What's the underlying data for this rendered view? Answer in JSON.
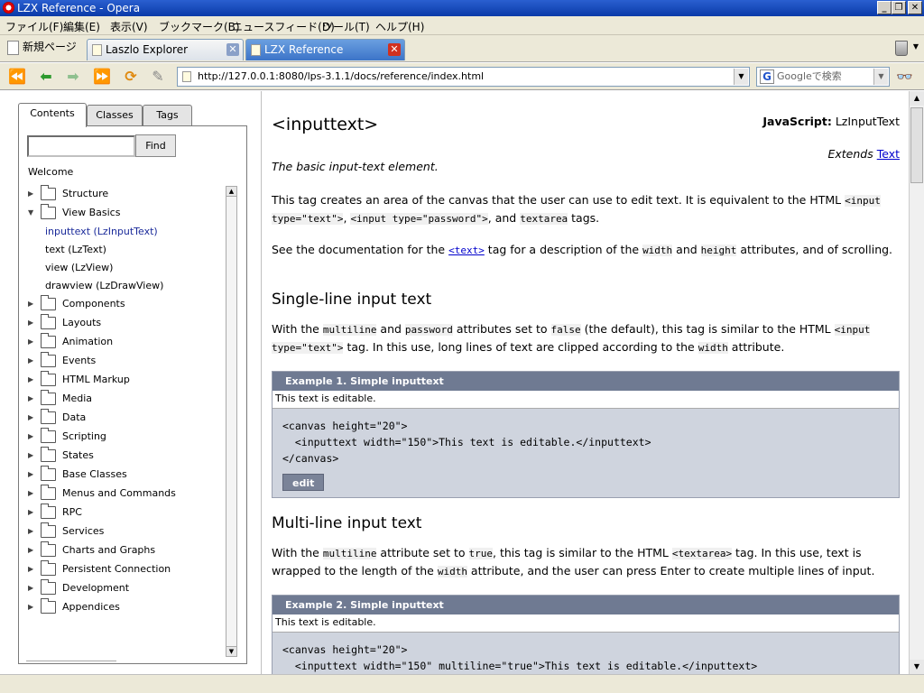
{
  "window": {
    "title": "LZX Reference - Opera"
  },
  "menubar": [
    "ファイル(F)",
    "編集(E)",
    "表示(V)",
    "ブックマーク(B)",
    "ニュースフィード(D)",
    "ツール(T)",
    "ヘルプ(H)"
  ],
  "tabs": {
    "new_page": "新規ページ",
    "items": [
      {
        "label": "Laszlo Explorer",
        "active": false
      },
      {
        "label": "LZX Reference",
        "active": true
      }
    ]
  },
  "navbar": {
    "url": "http://127.0.0.1:8080/lps-3.1.1/docs/reference/index.html",
    "search_placeholder": "Googleで検索"
  },
  "sidebar": {
    "tabs": [
      "Contents",
      "Classes",
      "Tags"
    ],
    "find_label": "Find",
    "find_value": "",
    "welcome": "Welcome",
    "tree": [
      {
        "label": "Structure",
        "type": "folder",
        "expanded": false
      },
      {
        "label": "View Basics",
        "type": "folder",
        "expanded": true
      },
      {
        "label": "inputtext (LzInputText)",
        "type": "child",
        "selected": true
      },
      {
        "label": "text (LzText)",
        "type": "child"
      },
      {
        "label": "view (LzView)",
        "type": "child"
      },
      {
        "label": "drawview (LzDrawView)",
        "type": "child"
      },
      {
        "label": "Components",
        "type": "folder"
      },
      {
        "label": "Layouts",
        "type": "folder"
      },
      {
        "label": "Animation",
        "type": "folder"
      },
      {
        "label": "Events",
        "type": "folder"
      },
      {
        "label": "HTML Markup",
        "type": "folder"
      },
      {
        "label": "Media",
        "type": "folder"
      },
      {
        "label": "Data",
        "type": "folder"
      },
      {
        "label": "Scripting",
        "type": "folder"
      },
      {
        "label": "States",
        "type": "folder"
      },
      {
        "label": "Base Classes",
        "type": "folder"
      },
      {
        "label": "Menus and Commands",
        "type": "folder"
      },
      {
        "label": "RPC",
        "type": "folder"
      },
      {
        "label": "Services",
        "type": "folder"
      },
      {
        "label": "Charts and Graphs",
        "type": "folder"
      },
      {
        "label": "Persistent Connection",
        "type": "folder"
      },
      {
        "label": "Development",
        "type": "folder"
      },
      {
        "label": "Appendices",
        "type": "folder"
      }
    ]
  },
  "doc": {
    "title": "<inputtext>",
    "js_label": "JavaScript:",
    "js_class": "LzInputText",
    "extends_label": "Extends",
    "extends_link": "Text",
    "summary": "The basic input-text element.",
    "p1": {
      "a": "This tag creates an area of the canvas that the user can use to edit text. It is equivalent to the HTML ",
      "c1": "<input type=\"text\">",
      "b": ", ",
      "c2": "<input type=\"password\">",
      "c": ", and ",
      "c3": "textarea",
      "d": " tags."
    },
    "p2": {
      "a": "See the documentation for the ",
      "link": "<text>",
      "b": " tag for a description of the ",
      "c1": "width",
      "c": " and ",
      "c2": "height",
      "d": " attributes, and of scrolling."
    },
    "h_single": "Single-line input text",
    "p3": {
      "a": "With the ",
      "c1": "multiline",
      "b": " and ",
      "c2": "password",
      "c": " attributes set to ",
      "c3": "false",
      "d": " (the default), this tag is similar to the HTML ",
      "c4": "<input type=\"text\">",
      "e": " tag. In this use, long lines of text are clipped according to the ",
      "c5": "width",
      "f": " attribute."
    },
    "example1": {
      "header": "Example 1. Simple inputtext",
      "live_text": "This text is editable.",
      "code": "<canvas height=\"20\">\n  <inputtext width=\"150\">This text is editable.</inputtext>\n</canvas>",
      "edit": "edit"
    },
    "h_multi": "Multi-line input text",
    "p4": {
      "a": "With the ",
      "c1": "multiline",
      "b": " attribute set to ",
      "c2": "true",
      "c": ", this tag is similar to the HTML ",
      "c3": "<textarea>",
      "d": " tag. In this use, text is wrapped to the length of the ",
      "c4": "width",
      "e": " attribute, and the user can press Enter to create multiple lines of input."
    },
    "example2": {
      "header": "Example 2. Simple inputtext",
      "live_text": "This text is editable.",
      "code": "<canvas height=\"20\">\n  <inputtext width=\"150\" multiline=\"true\">This text is editable.</inputtext>"
    }
  }
}
